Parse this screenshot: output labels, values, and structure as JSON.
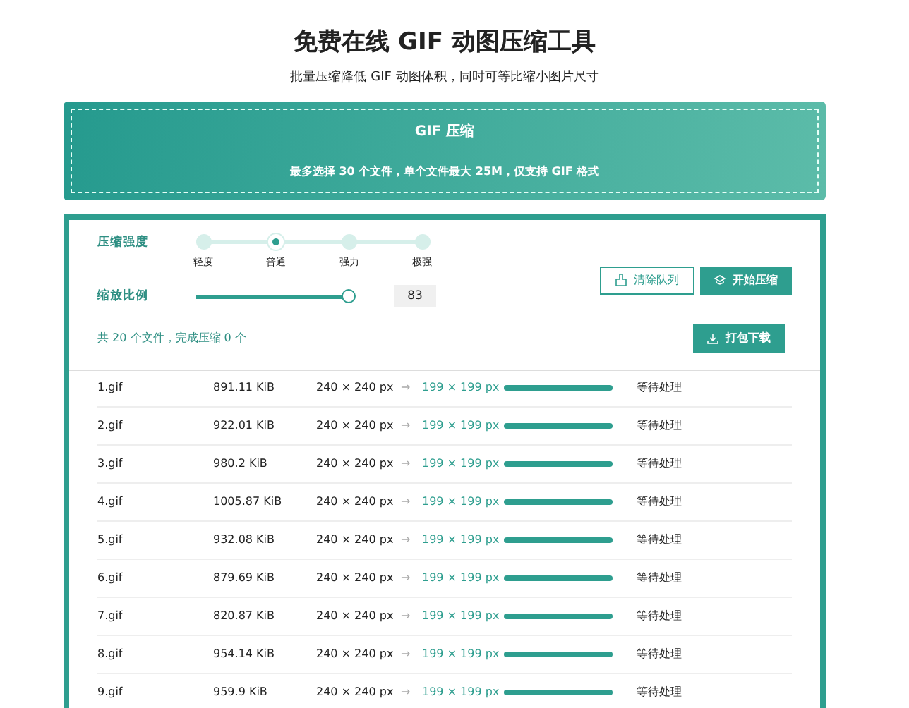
{
  "header": {
    "title": "免费在线 GIF 动图压缩工具",
    "subtitle": "批量压缩降低 GIF 动图体积，同时可等比缩小图片尺寸"
  },
  "upload": {
    "title": "GIF 压缩",
    "hint": "最多选择 30 个文件，单个文件最大 25M，仅支持 GIF 格式"
  },
  "settings": {
    "strength_label": "压缩强度",
    "strength_steps": [
      {
        "label": "轻度",
        "selected": false
      },
      {
        "label": "普通",
        "selected": true
      },
      {
        "label": "强力",
        "selected": false
      },
      {
        "label": "极强",
        "selected": false
      }
    ],
    "scale_label": "缩放比例",
    "scale": {
      "level": 0.83,
      "value": "83"
    }
  },
  "buttons": {
    "clear": "清除队列",
    "start": "开始压缩",
    "download": "打包下载"
  },
  "summary": "共 20 个文件，完成压缩 0 个",
  "files": [
    {
      "name": "1.gif",
      "size": "891.11 KiB",
      "original": "240 × 240 px",
      "arrow": "→",
      "target": "199 × 199 px",
      "level": 1,
      "status": "等待处理"
    },
    {
      "name": "2.gif",
      "size": "922.01 KiB",
      "original": "240 × 240 px",
      "arrow": "→",
      "target": "199 × 199 px",
      "level": 1,
      "status": "等待处理"
    },
    {
      "name": "3.gif",
      "size": "980.2 KiB",
      "original": "240 × 240 px",
      "arrow": "→",
      "target": "199 × 199 px",
      "level": 1,
      "status": "等待处理"
    },
    {
      "name": "4.gif",
      "size": "1005.87 KiB",
      "original": "240 × 240 px",
      "arrow": "→",
      "target": "199 × 199 px",
      "level": 1,
      "status": "等待处理"
    },
    {
      "name": "5.gif",
      "size": "932.08 KiB",
      "original": "240 × 240 px",
      "arrow": "→",
      "target": "199 × 199 px",
      "level": 1,
      "status": "等待处理"
    },
    {
      "name": "6.gif",
      "size": "879.69 KiB",
      "original": "240 × 240 px",
      "arrow": "→",
      "target": "199 × 199 px",
      "level": 1,
      "status": "等待处理"
    },
    {
      "name": "7.gif",
      "size": "820.87 KiB",
      "original": "240 × 240 px",
      "arrow": "→",
      "target": "199 × 199 px",
      "level": 1,
      "status": "等待处理"
    },
    {
      "name": "8.gif",
      "size": "954.14 KiB",
      "original": "240 × 240 px",
      "arrow": "→",
      "target": "199 × 199 px",
      "level": 1,
      "status": "等待处理"
    },
    {
      "name": "9.gif",
      "size": "959.9 KiB",
      "original": "240 × 240 px",
      "arrow": "→",
      "target": "199 × 199 px",
      "level": 1,
      "status": "等待处理"
    }
  ]
}
